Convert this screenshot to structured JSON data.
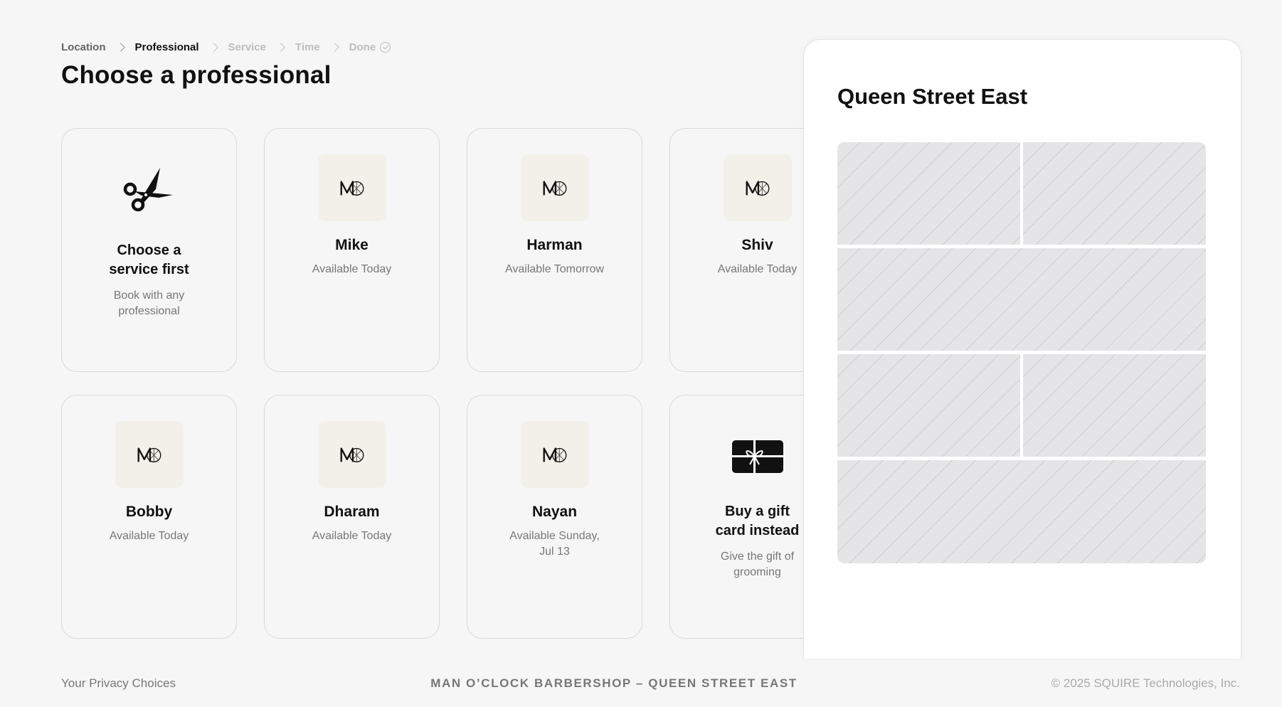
{
  "breadcrumb": {
    "location": "Location",
    "professional": "Professional",
    "service": "Service",
    "time": "Time",
    "done": "Done"
  },
  "page_title": "Choose a professional",
  "cards": {
    "service_first": {
      "title_line1": "Choose a",
      "title_line2": "service first",
      "sub_line1": "Book with any",
      "sub_line2": "professional"
    },
    "mike": {
      "name": "Mike",
      "availability": "Available Today"
    },
    "harman": {
      "name": "Harman",
      "availability": "Available Tomorrow"
    },
    "shiv": {
      "name": "Shiv",
      "availability": "Available Today"
    },
    "bobby": {
      "name": "Bobby",
      "availability": "Available Today"
    },
    "dharam": {
      "name": "Dharam",
      "availability": "Available Today"
    },
    "nayan": {
      "name": "Nayan",
      "availability_line1": "Available Sunday,",
      "availability_line2": "Jul 13"
    },
    "gift": {
      "title_line1": "Buy a gift",
      "title_line2": "card instead",
      "sub_line1": "Give the gift of",
      "sub_line2": "grooming"
    }
  },
  "panel": {
    "title": "Queen Street East"
  },
  "footer": {
    "privacy": "Your Privacy Choices",
    "shop": "MAN O’CLOCK BARBERSHOP – QUEEN STREET EAST",
    "copyright": "© 2025 SQUIRE Technologies, Inc."
  },
  "icons": {
    "breadcrumb_separator": "chevron-right-icon",
    "done": "check-circle-icon",
    "service": "scissors-icon",
    "professional_logo": "moc-logo-icon",
    "gift": "gift-card-icon"
  }
}
